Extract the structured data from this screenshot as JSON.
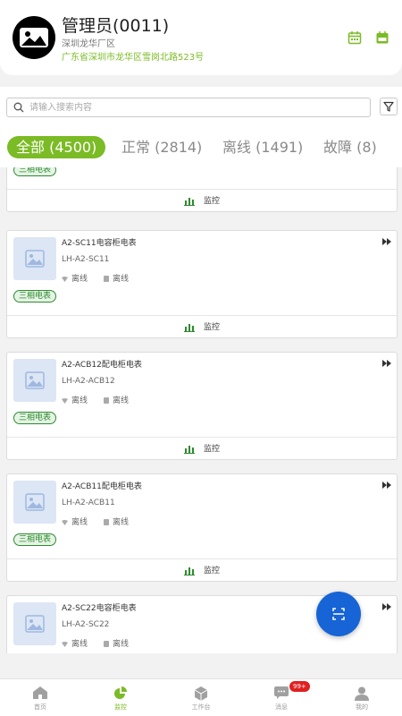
{
  "header": {
    "user_name": "管理员(0011)",
    "site_name": "深圳龙华厂区",
    "address": "广东省深圳市龙华区雪岗北路523号"
  },
  "search": {
    "placeholder": "请输入搜索内容",
    "value": ""
  },
  "tabs": [
    {
      "label": "全部 (4500)",
      "active": true
    },
    {
      "label": "正常 (2814)",
      "active": false
    },
    {
      "label": "离线 (1491)",
      "active": false
    },
    {
      "label": "故障 (8)",
      "active": false
    }
  ],
  "devices": [
    {
      "title": "",
      "code": "",
      "signal": "",
      "power": "",
      "type": "三相电表",
      "action": "监控"
    },
    {
      "title": "A2-SC11电容柜电表",
      "code": "LH-A2-SC11",
      "signal": "离线",
      "power": "离线",
      "type": "三相电表",
      "action": "监控"
    },
    {
      "title": "A2-ACB12配电柜电表",
      "code": "LH-A2-ACB12",
      "signal": "离线",
      "power": "离线",
      "type": "三相电表",
      "action": "监控"
    },
    {
      "title": "A2-ACB11配电柜电表",
      "code": "LH-A2-ACB11",
      "signal": "离线",
      "power": "离线",
      "type": "三相电表",
      "action": "监控"
    },
    {
      "title": "A2-SC22电容柜电表",
      "code": "LH-A2-SC22",
      "signal": "离线",
      "power": "离线",
      "type": "",
      "action": ""
    }
  ],
  "nav": [
    {
      "label": "首页",
      "icon": "home-icon",
      "active": false
    },
    {
      "label": "监控",
      "icon": "pie-chart-icon",
      "active": true
    },
    {
      "label": "工作台",
      "icon": "cube-icon",
      "active": false
    },
    {
      "label": "消息",
      "icon": "message-icon",
      "active": false,
      "badge": "99+"
    },
    {
      "label": "我的",
      "icon": "user-icon",
      "active": false
    }
  ],
  "colors": {
    "accent": "#7bbb25",
    "fab": "#1664d6",
    "badge_green": "#2e8b2e",
    "notify_red": "#e02020"
  }
}
